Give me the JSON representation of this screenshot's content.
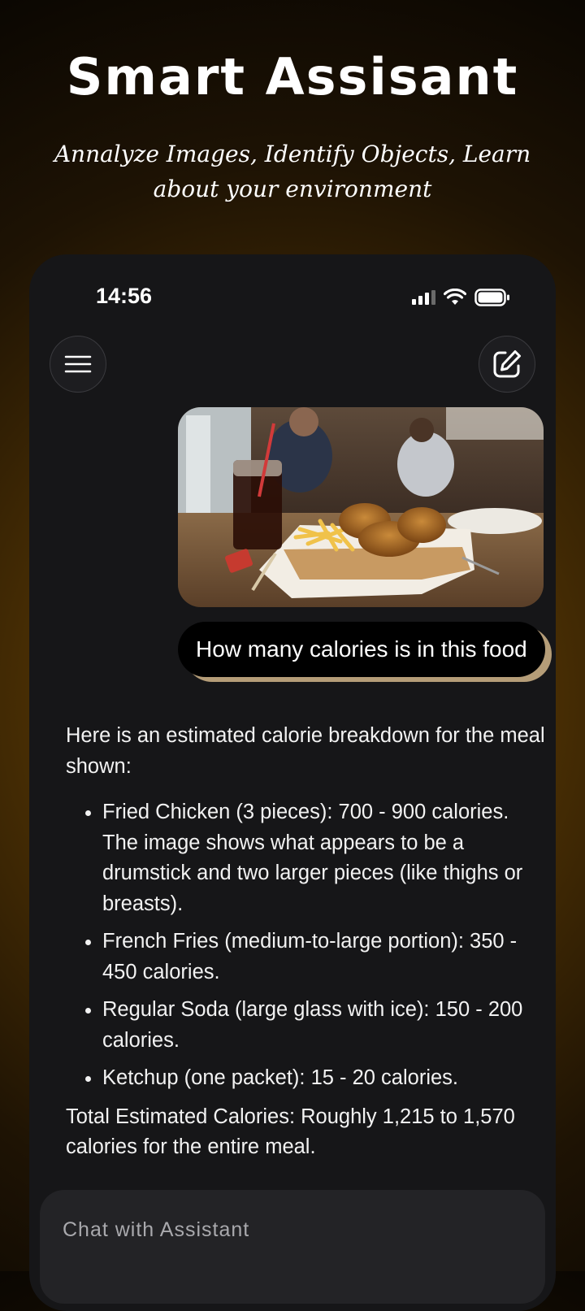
{
  "promo": {
    "title": "Smart Assisant",
    "subtitle": "Annalyze Images, Identify Objects, Learn about your environment"
  },
  "status_bar": {
    "time": "14:56",
    "icons": [
      "cellular-signal-icon",
      "wifi-icon",
      "battery-icon"
    ]
  },
  "header": {
    "menu_icon": "hamburger-menu-icon",
    "compose_icon": "edit-compose-icon"
  },
  "conversation": {
    "user_image": "photo of fried chicken, french fries, soda and ketchup on a restaurant table",
    "user_message": "How many calories is in this food",
    "assistant_intro": "Here is an estimated calorie breakdown for the meal shown:",
    "assistant_items": [
      "Fried Chicken (3 pieces): 700 - 900 calories. The image shows what appears to be a drumstick and two larger pieces (like thighs or breasts).",
      "French Fries (medium-to-large portion): 350 - 450 calories.",
      "Regular Soda (large glass with ice): 150 - 200 calories.",
      "Ketchup (one packet): 15 - 20 calories."
    ],
    "assistant_total": "Total Estimated Calories: Roughly 1,215 to 1,570 calories for the entire meal."
  },
  "input": {
    "placeholder": "Chat with Assistant",
    "value": ""
  },
  "colors": {
    "background_glow": "#6b4505",
    "phone_bg": "#161618",
    "input_bg": "#232326",
    "user_bubble": "#000000"
  }
}
